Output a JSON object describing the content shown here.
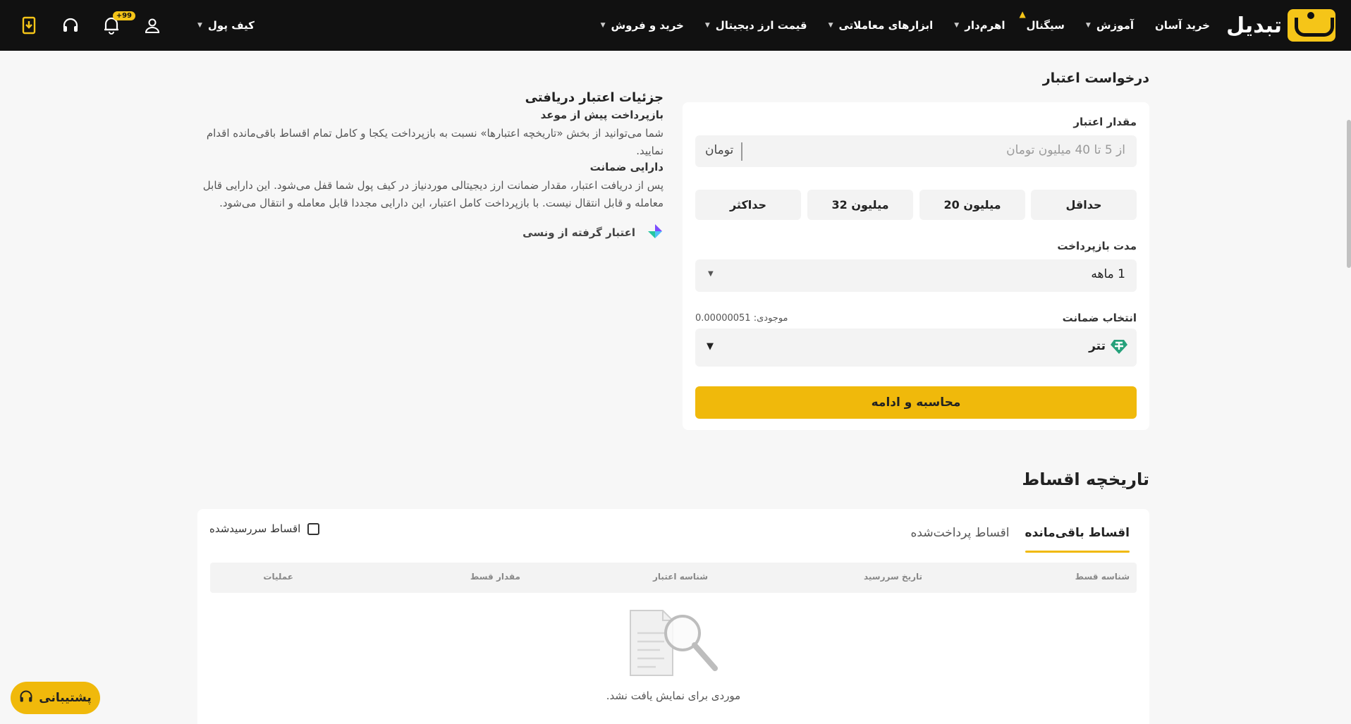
{
  "header": {
    "logo_text": "تبدیل",
    "nav": [
      {
        "label": "خرید و فروش",
        "dropdown": true
      },
      {
        "label": "قیمت ارز دیجیتال",
        "dropdown": true
      },
      {
        "label": "ابزارهای معاملاتی",
        "dropdown": true
      },
      {
        "label": "اهرم‌دار",
        "dropdown": true
      },
      {
        "label": "سیگنال",
        "dropdown": false
      },
      {
        "label": "آموزش",
        "dropdown": true
      },
      {
        "label": "خرید آسان",
        "dropdown": false
      }
    ],
    "wallet_label": "کیف پول",
    "notification_badge": "+99",
    "accent": "#f5c518"
  },
  "credit_request": {
    "title": "درخواست اعتبار",
    "amount_label": "مقدار اعتبار",
    "amount_placeholder": "از 5 تا 40 میلیون تومان",
    "amount_unit": "تومان",
    "presets": [
      "حداقل",
      "20 میلیون",
      "32 میلیون",
      "حداکثر"
    ],
    "repayment_label": "مدت بازپرداخت",
    "repayment_value": "1 ماهه",
    "collateral_label": "انتخاب ضمانت",
    "balance_label": "موجودی:",
    "balance_value": "0.00000051",
    "collateral_value": "تتر",
    "submit_label": "محاسبه و ادامه",
    "button_color": "#f0b90b"
  },
  "details": {
    "title": "جزئیات اعتبار دریافتی",
    "early_title": "بازپرداخت پیش از موعد",
    "early_text": "شما می‌توانید از بخش «تاریخچه اعتبارها» نسبت به بازپرداخت یکجا و کامل تمام اقساط باقی‌مانده اقدام نمایید.",
    "collateral_title": "دارایی ضمانت",
    "collateral_text": "پس از دریافت اعتبار، مقدار ضمانت ارز دیجیتالی موردنیاز در کیف پول شما قفل می‌شود. این دارایی قابل معامله و قابل انتقال نیست. با بازپرداخت کامل اعتبار، این دارایی مجددا قابل معامله و انتقال می‌شود.",
    "provider_text": "اعتبار گرفته از ونسی"
  },
  "installments": {
    "title": "تاریخچه اقساط",
    "tabs": [
      "اقساط باقی‌مانده",
      "اقساط پرداخت‌شده"
    ],
    "overdue_label": "اقساط سررسیدشده",
    "columns": [
      "شناسه قسط",
      "تاریخ سررسید",
      "شناسه اعتبار",
      "مقدار قسط",
      "عملیات"
    ],
    "empty_text": "موردی برای نمایش یافت نشد."
  },
  "support": {
    "label": "پشتیبانی"
  }
}
